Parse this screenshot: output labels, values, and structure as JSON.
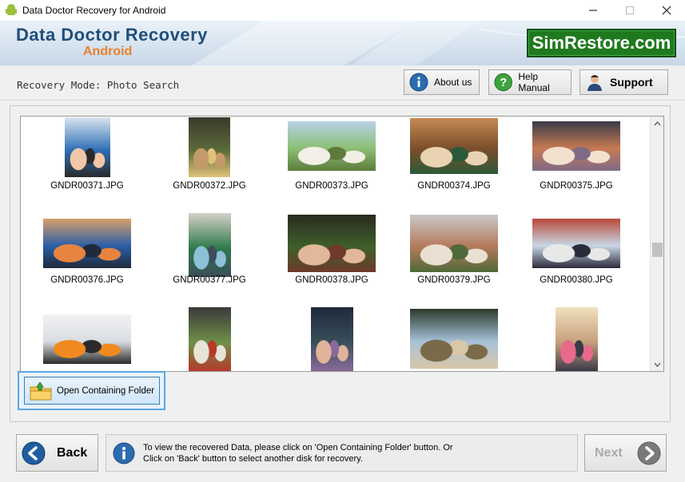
{
  "window": {
    "title": "Data Doctor Recovery for Android",
    "controls": {
      "minimize": "minimize-icon",
      "maximize": "maximize-icon",
      "close": "close-icon"
    }
  },
  "banner": {
    "brand_line1": "Data Doctor Recovery",
    "brand_line2": "Android",
    "site_badge": "SimRestore.com",
    "colors": {
      "brand": "#1f4e79",
      "accent": "#e8812a",
      "badge": "#1f7a1f"
    }
  },
  "toolbar": {
    "mode_label": "Recovery Mode: Photo Search",
    "about_label": "About us",
    "help_label": "Help Manual",
    "support_label": "Support"
  },
  "gallery": {
    "items": [
      {
        "name": "GNDR00371.JPG",
        "palette": [
          "#2f6fb5",
          "#f2c7a8",
          "#2a2a2a",
          "#d9e4ef"
        ]
      },
      {
        "name": "GNDR00372.JPG",
        "palette": [
          "#5b6a3a",
          "#c59a6a",
          "#e0c27a",
          "#3a3a2c"
        ]
      },
      {
        "name": "GNDR00373.JPG",
        "palette": [
          "#8bbf74",
          "#f1efe6",
          "#5d7b3b",
          "#b9d1e6"
        ]
      },
      {
        "name": "GNDR00374.JPG",
        "palette": [
          "#7a4e2a",
          "#e9d3b2",
          "#2b5a3a",
          "#c48a55"
        ]
      },
      {
        "name": "GNDR00375.JPG",
        "palette": [
          "#c77a52",
          "#f3e1d0",
          "#7f6a86",
          "#3a3a4a"
        ]
      },
      {
        "name": "GNDR00376.JPG",
        "palette": [
          "#2c5ea8",
          "#e7843f",
          "#1f2a3c",
          "#d8a06a"
        ]
      },
      {
        "name": "GNDR00377.JPG",
        "palette": [
          "#2f7a4a",
          "#8ec0d8",
          "#3c4d5a",
          "#d6d1c8"
        ]
      },
      {
        "name": "GNDR00378.JPG",
        "palette": [
          "#3e5f2a",
          "#e1b99a",
          "#6e3a2a",
          "#2a2a20"
        ]
      },
      {
        "name": "GNDR00379.JPG",
        "palette": [
          "#b57a5a",
          "#e9e0d2",
          "#4f6a3a",
          "#c9c9c9"
        ]
      },
      {
        "name": "GNDR00380.JPG",
        "palette": [
          "#c8d7e6",
          "#e8e8e8",
          "#2a2a3a",
          "#b84a3a"
        ]
      },
      {
        "name": "",
        "palette": [
          "#d9dde2",
          "#f08a1f",
          "#2a2a2a",
          "#f2f2f2"
        ]
      },
      {
        "name": "",
        "palette": [
          "#6f8f4a",
          "#e7e3d6",
          "#b53a2a",
          "#3a3a3a"
        ]
      },
      {
        "name": "",
        "palette": [
          "#3a4e5a",
          "#e0b39a",
          "#8a6a9a",
          "#1f2a3a"
        ]
      },
      {
        "name": "",
        "palette": [
          "#a8c2d8",
          "#7a6a4a",
          "#d9c7a8",
          "#2a3a2a"
        ]
      },
      {
        "name": "",
        "palette": [
          "#c7a07a",
          "#e86a8a",
          "#3a3a4a",
          "#f0e0c0"
        ]
      }
    ]
  },
  "actions": {
    "open_folder_label": "Open Containing Folder"
  },
  "footer": {
    "back_label": "Back",
    "next_label": "Next",
    "info_line1": "To view the recovered Data, please click on 'Open Containing Folder' button. Or",
    "info_line2": "Click on 'Back' button to select another disk for recovery."
  }
}
